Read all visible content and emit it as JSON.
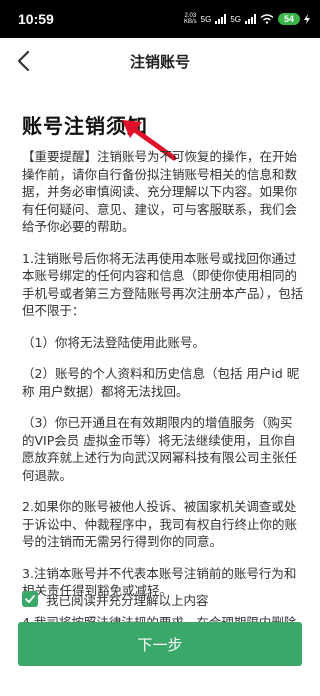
{
  "status_bar": {
    "time": "10:59",
    "net_speed_value": "2.03",
    "net_speed_unit": "KB/s",
    "network_type": "5G",
    "network_type2": "5G",
    "battery": "54"
  },
  "header": {
    "title": "注销账号"
  },
  "page_title": "账号注销须知",
  "paragraphs": [
    "【重要提醒】注销账号为不可恢复的操作，在开始操作前，请你自行备份拟注销账号相关的信息和数据，并务必审慎阅读、充分理解以下内容。如果你有任何疑问、意见、建议，可与客服联系，我们会给予你必要的帮助。",
    "1.注销账号后你将无法再使用本账号或找回你通过本账号绑定的任何内容和信息（即使你使用相同的手机号或者第三方登陆账号再次注册本产品），包括但不限于：",
    "（1）你将无法登陆使用此账号。",
    "（2）账号的个人资料和历史信息（包括 用户id 昵称 用户数据）都将无法找回。",
    "（3）你已开通且在有效期限内的增值服务（购买的VIP会员 虚拟金币等）将无法继续使用，且你自愿放弃就上述行为向武汉网幂科技有限公司主张任何退款。",
    "2.如果你的账号被他人投诉、被国家机关调查或处于诉讼中、仲裁程序中，我司有权自行终止你的账号的注销而无需另行得到你的同意。",
    "3.注销本账号并不代表本账号注销前的账号行为和相关责任得到豁免或减轻。",
    "4.我司将按照法律法规的要求，在合理期限内删除本账号相关的全部信息与内容。"
  ],
  "agree": {
    "checked": true,
    "label": "我已阅读并充分理解以上内容"
  },
  "next_button": {
    "label": "下一步"
  },
  "colors": {
    "accent": "#3aa868",
    "arrow": "#e0102a",
    "battery": "#3ab54a"
  }
}
